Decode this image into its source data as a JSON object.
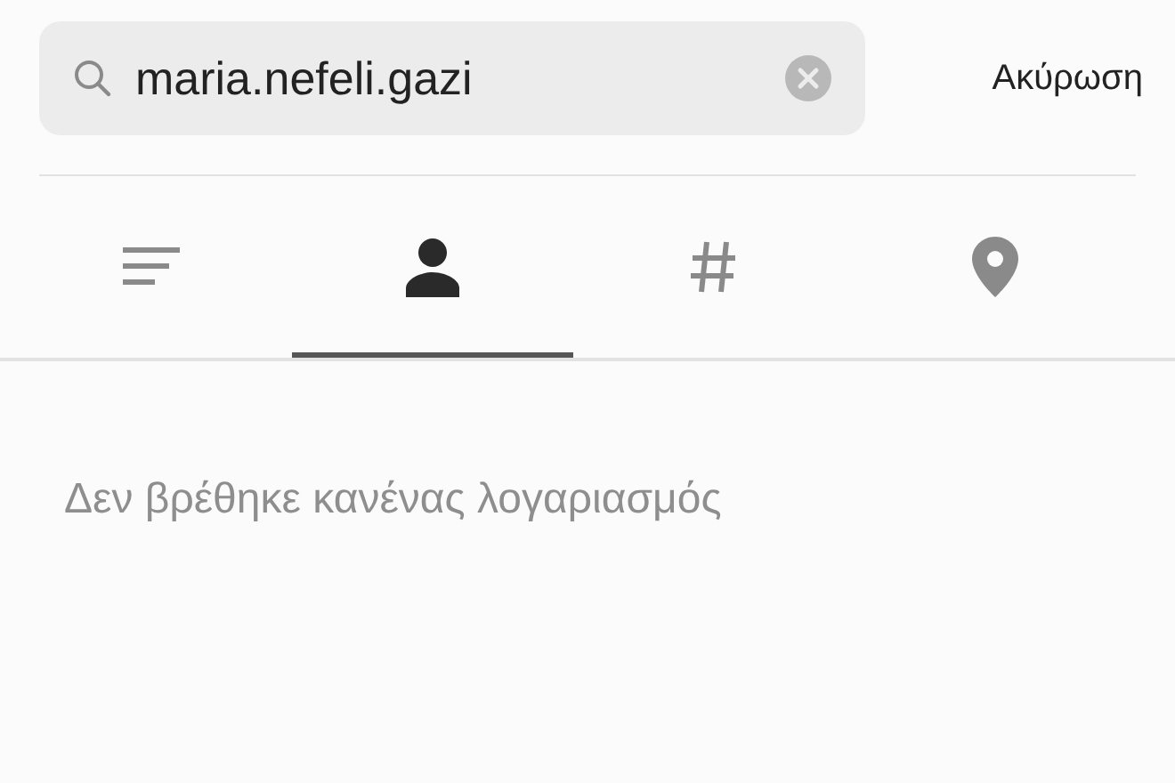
{
  "search": {
    "value": "maria.nefeli.gazi"
  },
  "cancel": "Ακύρωση",
  "tabs": [
    {
      "kind": "top",
      "selected": false
    },
    {
      "kind": "accounts",
      "selected": true
    },
    {
      "kind": "tags",
      "selected": false
    },
    {
      "kind": "places",
      "selected": false
    }
  ],
  "message": "Δεν βρέθηκε κανένας λογαριασμός"
}
